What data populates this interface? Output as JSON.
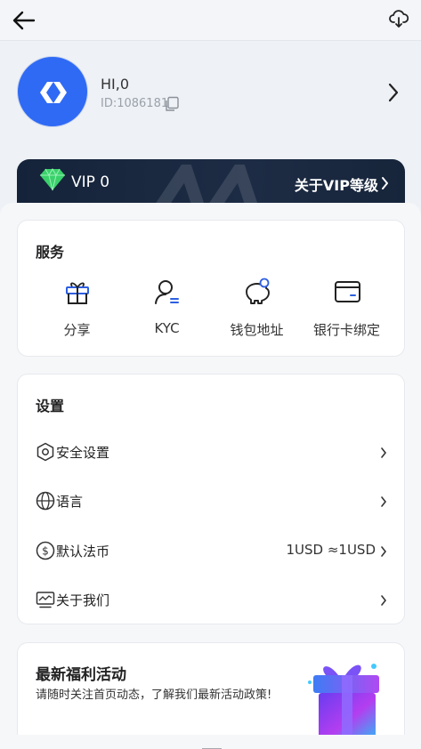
{
  "header": {
    "back_icon": "arrow-left-icon",
    "download_icon": "cloud-download-icon"
  },
  "profile": {
    "greeting": "HI,0",
    "user_id": "ID:1086181",
    "avatar_color": "#2f6af5"
  },
  "vip": {
    "level_label": "VIP 0",
    "link_label": "关于VIP等级",
    "diamond_color": "#3ad16b"
  },
  "services": {
    "title": "服务",
    "items": [
      {
        "label": "分享",
        "icon": "gift-icon"
      },
      {
        "label": "KYC",
        "icon": "user-verify-icon"
      },
      {
        "label": "钱包地址",
        "icon": "piggy-bank-icon"
      },
      {
        "label": "银行卡绑定",
        "icon": "bank-card-icon"
      }
    ]
  },
  "settings": {
    "title": "设置",
    "items": [
      {
        "label": "安全设置",
        "icon": "security-hexagon-icon",
        "value": ""
      },
      {
        "label": "语言",
        "icon": "globe-icon",
        "value": ""
      },
      {
        "label": "默认法币",
        "icon": "dollar-coin-icon",
        "value": "1USD ≈1USD"
      },
      {
        "label": "关于我们",
        "icon": "monitor-chart-icon",
        "value": ""
      }
    ]
  },
  "promo": {
    "title": "最新福利活动",
    "subtitle": "请随时关注首页动态，了解我们最新活动政策!"
  },
  "colors": {
    "accent": "#2f6af5",
    "vip_bg": "#15233a"
  }
}
